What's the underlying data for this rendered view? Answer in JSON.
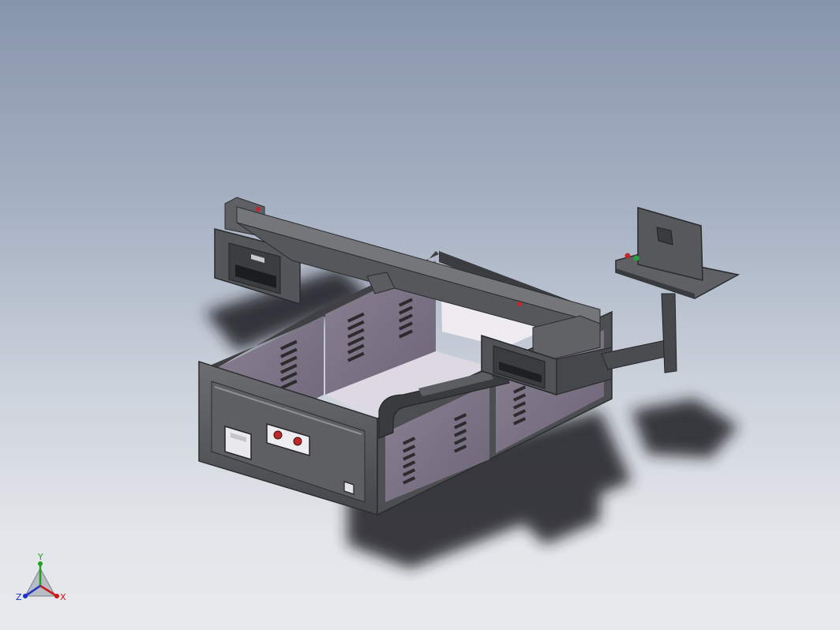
{
  "viewport": {
    "background_top": "#8795ab",
    "background_bottom": "#e7e9ec"
  },
  "model": {
    "frame_color": "#4d4f52",
    "panel_color": "#80788a",
    "dark_color": "#2e2f31",
    "red_button": "#c0282c",
    "green_button": "#2aa140"
  },
  "triad": {
    "x_label": "X",
    "y_label": "Y",
    "z_label": "Z",
    "x_color": "#d01818",
    "y_color": "#20a020",
    "z_color": "#2030c0"
  }
}
